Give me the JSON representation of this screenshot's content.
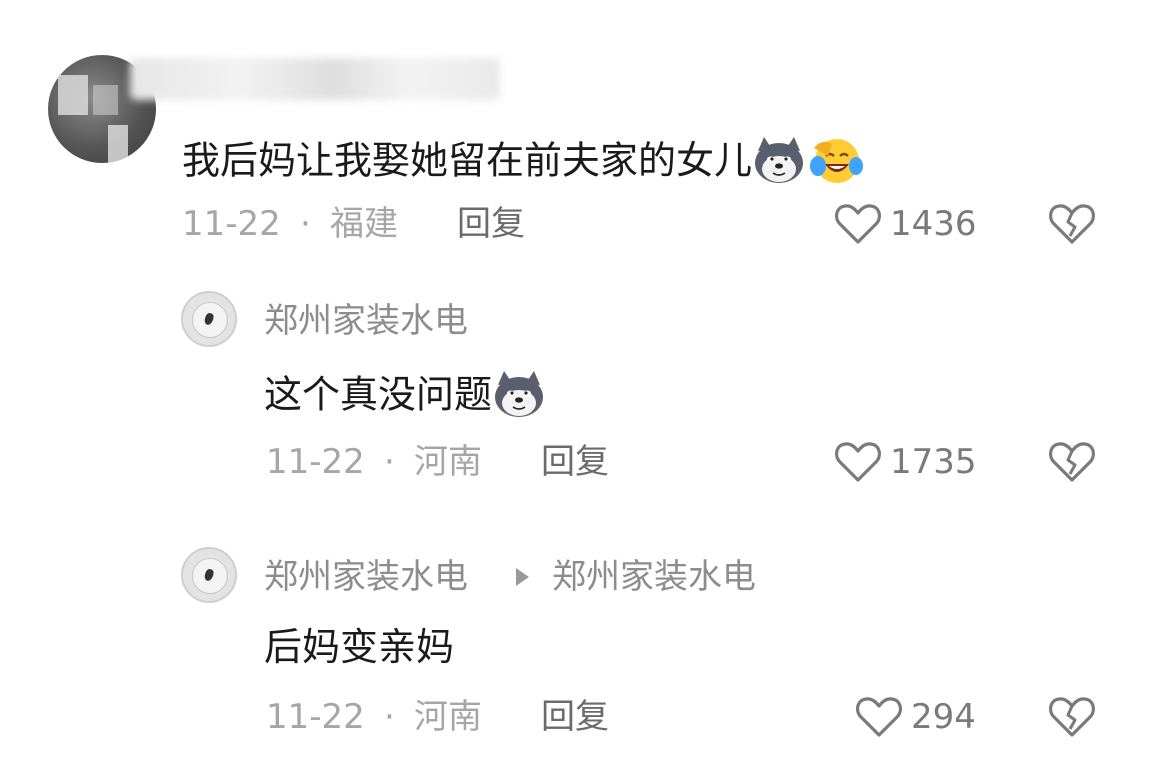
{
  "comments": [
    {
      "text": "我后妈让我娶她留在前夫家的女儿",
      "emojis": [
        "dog-emoji",
        "laugh-cry-emoji"
      ],
      "date": "11-22",
      "separator": "·",
      "location": "福建",
      "reply_label": "回复",
      "likes": "1436"
    },
    {
      "username": "郑州家装水电",
      "text": "这个真没问题",
      "emojis": [
        "dog-emoji"
      ],
      "date": "11-22",
      "separator": "·",
      "location": "河南",
      "reply_label": "回复",
      "likes": "1735"
    },
    {
      "username": "郑州家装水电",
      "reply_to": "郑州家装水电",
      "text": "后妈变亲妈",
      "date": "11-22",
      "separator": "·",
      "location": "河南",
      "reply_label": "回复",
      "likes": "294"
    }
  ],
  "colors": {
    "text": "#1a1a1a",
    "meta": "#a6a6a6",
    "username": "#8d8d8d",
    "icon": "#7a7a7a"
  }
}
